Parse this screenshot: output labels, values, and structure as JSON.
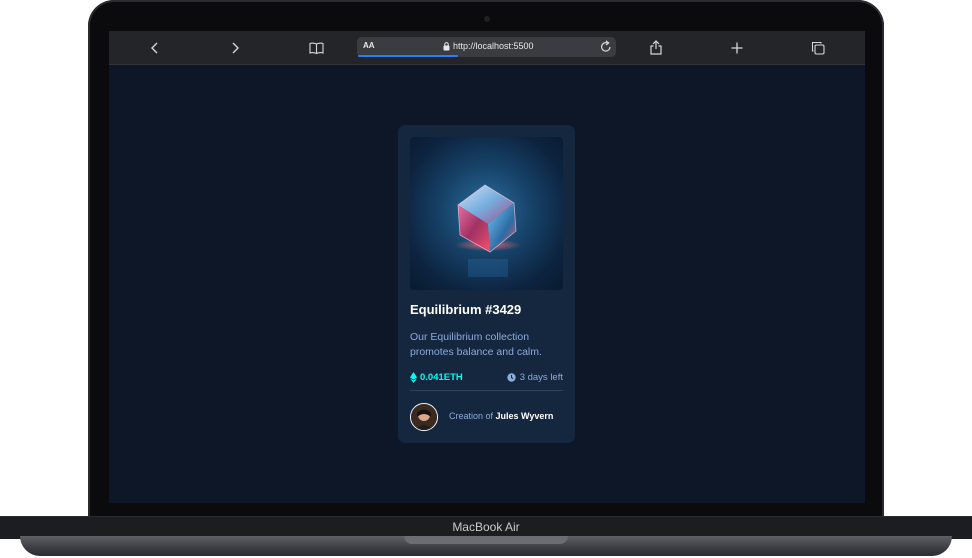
{
  "device": {
    "label": "MacBook Air"
  },
  "browser": {
    "text_size_label": "AA",
    "url": "http://localhost:5500",
    "progress": 0.39,
    "icons": [
      "back-icon",
      "forward-icon",
      "bookmarks-icon",
      "lock-icon",
      "reload-icon",
      "share-icon",
      "new-tab-icon",
      "tabs-icon"
    ]
  },
  "card": {
    "image_alt": "Equilibrium cube artwork",
    "title": "Equilibrium #3429",
    "description": "Our Equilibrium collection promotes balance and calm.",
    "price": "0.041ETH",
    "time_left": "3 days left",
    "creator_prefix": "Creation of",
    "creator_name": "Jules Wyvern"
  },
  "colors": {
    "page_bg": "#0d1728",
    "card_bg": "#15263f",
    "accent_cyan": "#00fff7",
    "soft_blue": "#8bacd9",
    "white": "#ffffff"
  }
}
